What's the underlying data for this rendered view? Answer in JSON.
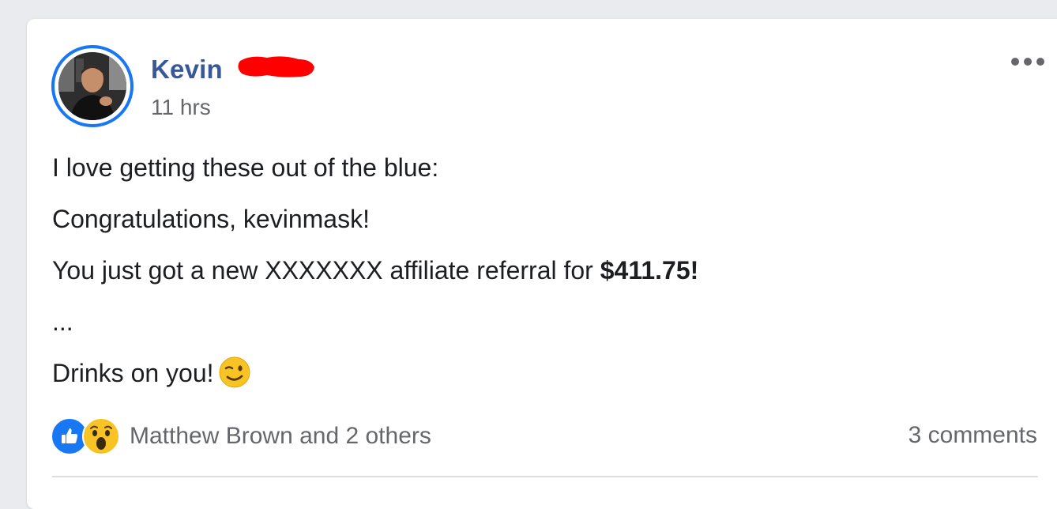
{
  "post": {
    "author_name": "Kevin",
    "timestamp": "11 hrs",
    "lines": {
      "l1": "I love getting these out of the blue:",
      "l2": "Congratulations, kevinmask!",
      "l3_prefix": "You just got a new XXXXXXX affiliate referral for ",
      "l3_amount": "$411.75!",
      "l4": "...",
      "l5": "Drinks on you!"
    },
    "emoji": "winking-face"
  },
  "reactions": {
    "types": [
      "like",
      "wow"
    ],
    "summary": "Matthew Brown and 2 others"
  },
  "comments": {
    "count_label": "3 comments"
  },
  "colors": {
    "author_link": "#385898",
    "secondary_text": "#65676b",
    "like_blue": "#1877f2",
    "redaction_red": "#ff0000"
  }
}
